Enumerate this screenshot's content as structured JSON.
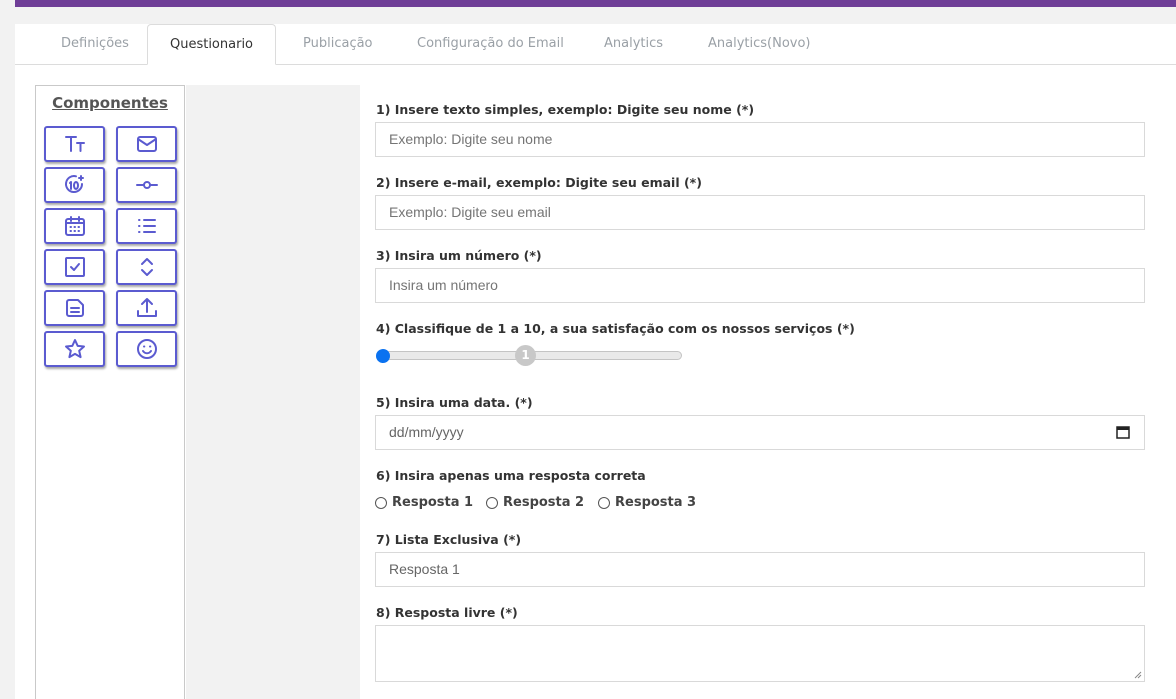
{
  "tabs": [
    {
      "label": "Definições"
    },
    {
      "label": "Questionario"
    },
    {
      "label": "Publicação"
    },
    {
      "label": "Configuração do Email"
    },
    {
      "label": "Analytics"
    },
    {
      "label": "Analytics(Novo)"
    }
  ],
  "active_tab": "Questionario",
  "components_panel": {
    "title": "Componentes",
    "items": [
      {
        "icon": "text-icon"
      },
      {
        "icon": "email-icon"
      },
      {
        "icon": "number-icon"
      },
      {
        "icon": "slider-icon"
      },
      {
        "icon": "calendar-icon"
      },
      {
        "icon": "list-icon"
      },
      {
        "icon": "checkbox-icon"
      },
      {
        "icon": "select-icon"
      },
      {
        "icon": "document-icon"
      },
      {
        "icon": "upload-icon"
      },
      {
        "icon": "star-icon"
      },
      {
        "icon": "smiley-icon"
      }
    ]
  },
  "form": {
    "q1": {
      "label": "1) Insere texto simples, exemplo: Digite seu nome (*)",
      "placeholder": "Exemplo: Digite seu nome"
    },
    "q2": {
      "label": "2) Insere e-mail, exemplo: Digite seu email (*)",
      "placeholder": "Exemplo: Digite seu email"
    },
    "q3": {
      "label": "3) Insira um número (*)",
      "placeholder": "Insira um número"
    },
    "q4": {
      "label": "4) Classifique de 1 a 10, a sua satisfação com os nossos serviços (*)",
      "value": "1",
      "min": 1,
      "max": 10
    },
    "q5": {
      "label": "5) Insira uma data. (*)",
      "placeholder": "dd/mm/yyyy"
    },
    "q6": {
      "label": "6) Insira apenas uma resposta correta",
      "options": [
        "Resposta 1",
        "Resposta 2",
        "Resposta 3"
      ]
    },
    "q7": {
      "label": "7) Lista Exclusiva (*)",
      "value": "Resposta 1"
    },
    "q8": {
      "label": "8) Resposta livre (*)"
    }
  },
  "colors": {
    "brand": "#6f3e97",
    "icon": "#5b5bd0",
    "slider": "#0a72f0"
  }
}
